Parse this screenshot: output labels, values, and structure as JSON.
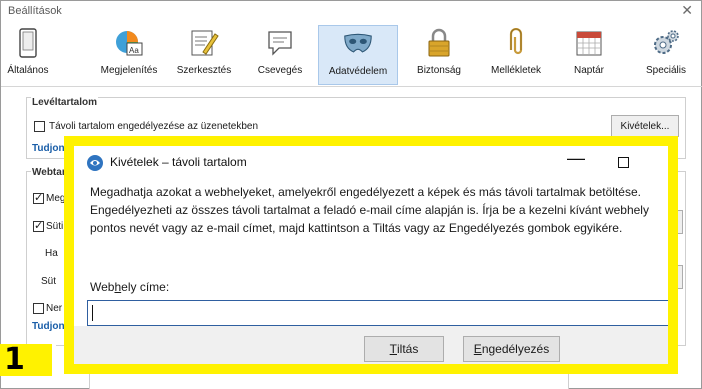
{
  "window": {
    "title": "Beállítások",
    "close_glyph": "✕"
  },
  "toolbar": {
    "items": [
      {
        "label": "Általános",
        "icon": "phone-icon"
      },
      {
        "label": "Megjelenítés",
        "icon": "appearance-icon"
      },
      {
        "label": "Szerkesztés",
        "icon": "edit-icon"
      },
      {
        "label": "Csevegés",
        "icon": "chat-icon"
      },
      {
        "label": "Adatvédelem",
        "icon": "mask-icon",
        "active": true
      },
      {
        "label": "Biztonság",
        "icon": "lock-icon"
      },
      {
        "label": "Mellékletek",
        "icon": "paperclip-icon"
      },
      {
        "label": "Naptár",
        "icon": "calendar-icon"
      },
      {
        "label": "Speciális",
        "icon": "gears-icon"
      }
    ]
  },
  "settings": {
    "mail_content_title": "Levéltartalom",
    "remote_content_checkbox": "Távoli tartalom engedélyezése az üzenetekben",
    "exceptions_button": "Kivételek...",
    "learn_more_1": "Tudjon",
    "web_content_title": "Webtar",
    "checkbox_a": "Meg",
    "checkbox_b": "Süti",
    "text_ha": "Ha",
    "text_sut": "Süt",
    "checkbox_c": "Ner",
    "learn_more_2": "Tudjon"
  },
  "badge": {
    "number": "1"
  },
  "dialog": {
    "title": "Kivételek – távoli tartalom",
    "minimize_glyph": "—",
    "description": "Megadhatja azokat a webhelyeket, amelyekről engedélyezett a képek és más távoli tartalmak betöltése. Engedélyezheti az összes távoli tartalmat a feladó e-mail címe alapján is. Írja be a kezelni kívánt webhely pontos nevét vagy az e-mail címet, majd kattintson a Tiltás vagy az Engedélyezés gombok egyikére.",
    "site_label": "Webhely címe:",
    "site_input_value": "",
    "block_button": "Tiltás",
    "allow_button": "Engedélyezés"
  }
}
